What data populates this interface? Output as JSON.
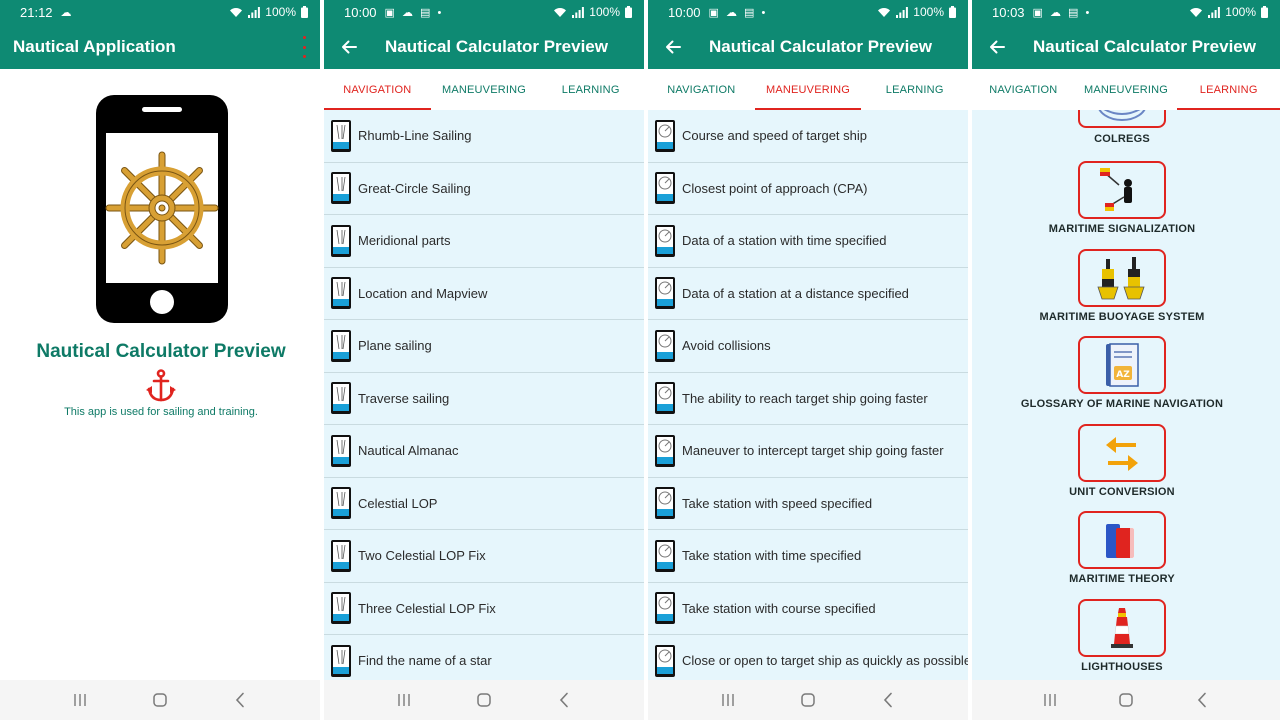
{
  "screens": {
    "home": {
      "time": "21:12",
      "battery": "100%",
      "title": "Nautical Application",
      "app_name": "Nautical Calculator Preview",
      "description": "This app is used for sailing and training."
    },
    "navigation": {
      "time": "10:00",
      "battery": "100%",
      "title": "Nautical Calculator Preview",
      "items": [
        "Rhumb-Line Sailing",
        "Great-Circle Sailing",
        "Meridional parts",
        "Location and Mapview",
        "Plane sailing",
        "Traverse sailing",
        "Nautical Almanac",
        "Celestial LOP",
        "Two Celestial LOP Fix",
        "Three Celestial LOP Fix",
        "Find the name of a star"
      ]
    },
    "maneuvering": {
      "time": "10:00",
      "battery": "100%",
      "title": "Nautical Calculator Preview",
      "items": [
        "Course and speed of target ship",
        "Closest point of approach (CPA)",
        "Data of a station with time specified",
        "Data of a station at a distance specified",
        "Avoid collisions",
        "The ability to reach target ship going faster",
        "Maneuver to intercept target ship going faster",
        "Take station with speed specified",
        "Take station with time specified",
        "Take station with course specified",
        "Close or open to target ship as quickly as possible"
      ]
    },
    "learning": {
      "time": "10:03",
      "battery": "100%",
      "title": "Nautical Calculator Preview",
      "items": [
        "COLREGS",
        "MARITIME SIGNALIZATION",
        "MARITIME BUOYAGE SYSTEM",
        "GLOSSARY OF MARINE NAVIGATION",
        "UNIT CONVERSION",
        "MARITIME THEORY",
        "LIGHTHOUSES"
      ]
    }
  },
  "tabs": {
    "navigation": "NAVIGATION",
    "maneuvering": "MANEUVERING",
    "learning": "LEARNING"
  },
  "colors": {
    "primary": "#0e8a73",
    "accent": "#e0241f",
    "list_background": "#e6f6fc"
  },
  "icons": {
    "status": [
      "wifi-icon",
      "signal-icon",
      "battery-icon"
    ],
    "navigation_row": "chart-card-icon",
    "maneuvering_row": "radar-card-icon",
    "system_nav": [
      "recent-apps-icon",
      "home-icon",
      "back-icon"
    ]
  }
}
